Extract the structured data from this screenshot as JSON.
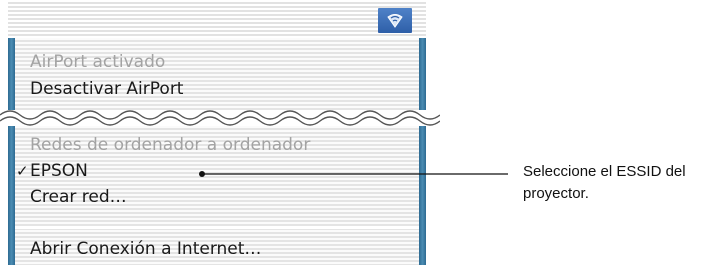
{
  "menu": {
    "items": [
      {
        "label": "AirPort activado",
        "state": "disabled"
      },
      {
        "label": "Desactivar AirPort",
        "state": "enabled"
      },
      {
        "label": "Redes de ordenador a ordenador",
        "state": "disabled"
      },
      {
        "label": "EPSON",
        "state": "enabled",
        "checked": true
      },
      {
        "label": "Crear red…",
        "state": "enabled"
      },
      {
        "label": "Abrir Conexión a Internet…",
        "state": "enabled"
      }
    ],
    "check_glyph": "✓"
  },
  "menubar": {
    "icon": "airport-icon"
  },
  "callout": {
    "text_line1": "Seleccione el ESSID del",
    "text_line2": "proyector."
  },
  "colors": {
    "menubar_icon": "#3b6fb8",
    "side_edge": "#3a7aa3",
    "disabled_text": "#a3a3a3",
    "enabled_text": "#1a1a1a"
  }
}
